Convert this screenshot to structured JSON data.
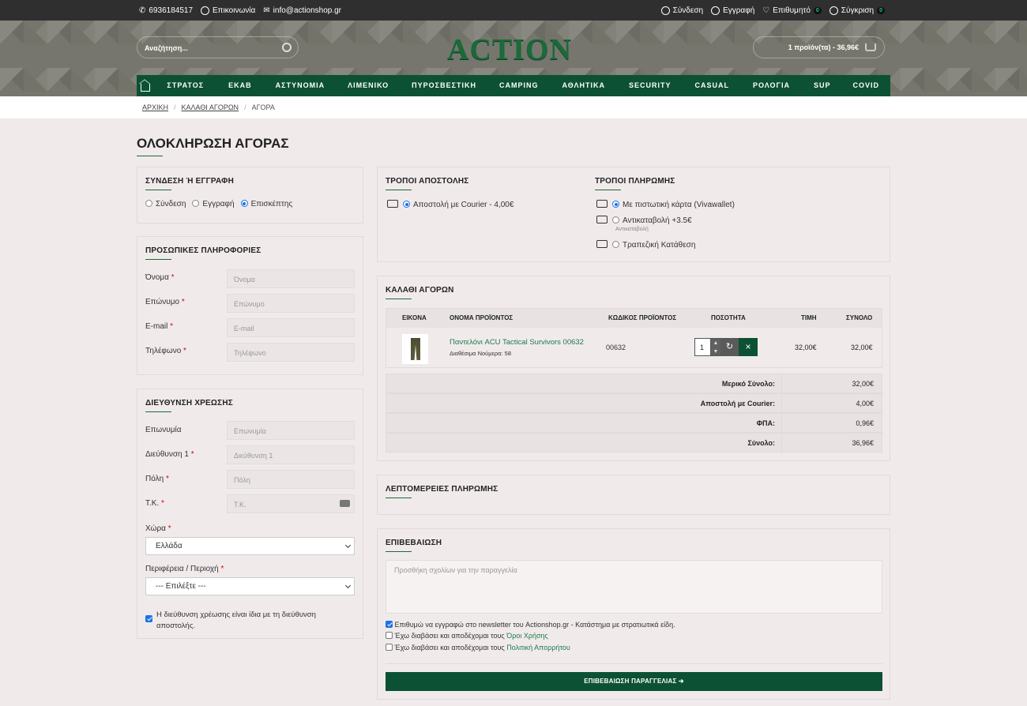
{
  "topbar": {
    "phone": "6936184517",
    "contact": "Επικοινωνία",
    "email": "info@actionshop.gr",
    "login": "Σύνδεση",
    "register": "Εγγραφή",
    "wishlist": "Επιθυμητό",
    "wishlist_count": "0",
    "compare": "Σύγκριση",
    "compare_count": "0"
  },
  "header": {
    "search_placeholder": "Αναζήτηση...",
    "logo": "ACTION",
    "cart": "1 προϊόν(τα) - 36,96€"
  },
  "nav": [
    "ΣΤΡΑΤΟΣ",
    "ΕΚΑΒ",
    "ΑΣΤΥΝΟΜΙΑ",
    "ΛΙΜΕΝΙΚΟ",
    "ΠΥΡΟΣΒΕΣΤΙΚΗ",
    "CAMPING",
    "ΑΘΛΗΤΙΚΑ",
    "SECURITY",
    "CASUAL",
    "ΡΟΛΟΓΙΑ",
    "SUP",
    "COVID"
  ],
  "breadcrumb": [
    "ΑΡΧΙΚΗ",
    "ΚΑΛΑΘΙ ΑΓΟΡΩΝ",
    "ΑΓΟΡΑ"
  ],
  "page_title": "ΟΛΟΚΛΗΡΩΣΗ ΑΓΟΡΑΣ",
  "account": {
    "title": "ΣΥΝΔΕΣΗ Ή ΕΓΓΡΑΦΗ",
    "options": [
      "Σύνδεση",
      "Εγγραφή",
      "Επισκέπτης"
    ],
    "selected": "Επισκέπτης"
  },
  "personal": {
    "title": "ΠΡΟΣΩΠΙΚΕΣ ΠΛΗΡΟΦΟΡΙΕΣ",
    "fields": [
      {
        "label": "Όνομα",
        "placeholder": "Όνομα"
      },
      {
        "label": "Επώνυμο",
        "placeholder": "Επώνυμο"
      },
      {
        "label": "E-mail",
        "placeholder": "E-mail"
      },
      {
        "label": "Τηλέφωνο",
        "placeholder": "Τηλέφωνο"
      }
    ]
  },
  "billing": {
    "title": "ΔΙΕΥΘΥΝΣΗ ΧΡΕΩΣΗΣ",
    "fields": [
      {
        "label": "Επωνυμία",
        "placeholder": "Επωνυμία"
      },
      {
        "label": "Διεύθυνση 1",
        "placeholder": "Διεύθυνση 1"
      },
      {
        "label": "Πόλη",
        "placeholder": "Πόλη"
      },
      {
        "label": "Τ.Κ.",
        "placeholder": "Τ.Κ."
      }
    ],
    "country_label": "Χώρα",
    "country_value": "Ελλάδα",
    "region_label": "Περιφέρεια / Περιοχή",
    "region_value": "--- Επιλέξτε ---",
    "same_address_line1": "Η διεύθυνση χρέωσης είναι ίδια με τη διεύθυνση",
    "same_address_line2": "αποστολής."
  },
  "shipping": {
    "title": "ΤΡΟΠΟΙ ΑΠΟΣΤΟΛΗΣ",
    "option": "Αποστολή με Courier - 4,00€"
  },
  "payment": {
    "title": "ΤΡΟΠΟΙ ΠΛΗΡΩΜΗΣ",
    "options": [
      "Με πιστωτική κάρτα (Vivawallet)",
      "Αντικαταβολή +3.5€",
      "Τραπεζική Κατάθεση"
    ],
    "cod_sub": "Αντικαταβολή"
  },
  "cart": {
    "title": "ΚΑΛΑΘΙ ΑΓΟΡΩΝ",
    "headers": [
      "ΕΙΚΟΝΑ",
      "ΟΝΟΜΑ ΠΡΟΪΟΝΤΟΣ",
      "ΚΩΔΙΚΟΣ ΠΡΟΪΟΝΤΟΣ",
      "ΠΟΣΟΤΗΤΑ",
      "ΤΙΜΗ",
      "ΣΥΝΟΛΟ"
    ],
    "item": {
      "name": "Παντελόνι ACU Tactical Survivors 00632",
      "sizes": "Διαθέσιμα Νούμερα: 58",
      "code": "00632",
      "qty": "1",
      "price": "32,00€",
      "total": "32,00€"
    },
    "totals": [
      {
        "label": "Μερικό Σύνολο:",
        "value": "32,00€"
      },
      {
        "label": "Αποστολή με Courier:",
        "value": "4,00€"
      },
      {
        "label": "ΦΠΑ:",
        "value": "0,96€"
      },
      {
        "label": "Σύνολο:",
        "value": "36,96€"
      }
    ]
  },
  "payment_details": {
    "title": "ΛΕΠΤΟΜΕΡΕΙΕΣ ΠΛΗΡΩΜΗΣ"
  },
  "confirm": {
    "title": "ΕΠΙΒΕΒΑΙΩΣΗ",
    "comment_placeholder": "Προσθήκη σχολίων για την παραγγελία",
    "newsletter": "Επιθυμώ να εγγραφώ στο newsletter του Actionshop.gr - Κατάστημα με στρατιωτικά είδη.",
    "terms_text": "Έχω διαβάσει και αποδέχομαι τους",
    "terms_link": "Όροι Χρήσης",
    "privacy_text": "Έχω διαβάσει και αποδέχομαι τους",
    "privacy_link": "Πολιτική Απορρήτου",
    "button": "ΕΠΙΒΕΒΑΙΩΣΗ ΠΑΡΑΓΓΕΛΙΑΣ ➔"
  }
}
